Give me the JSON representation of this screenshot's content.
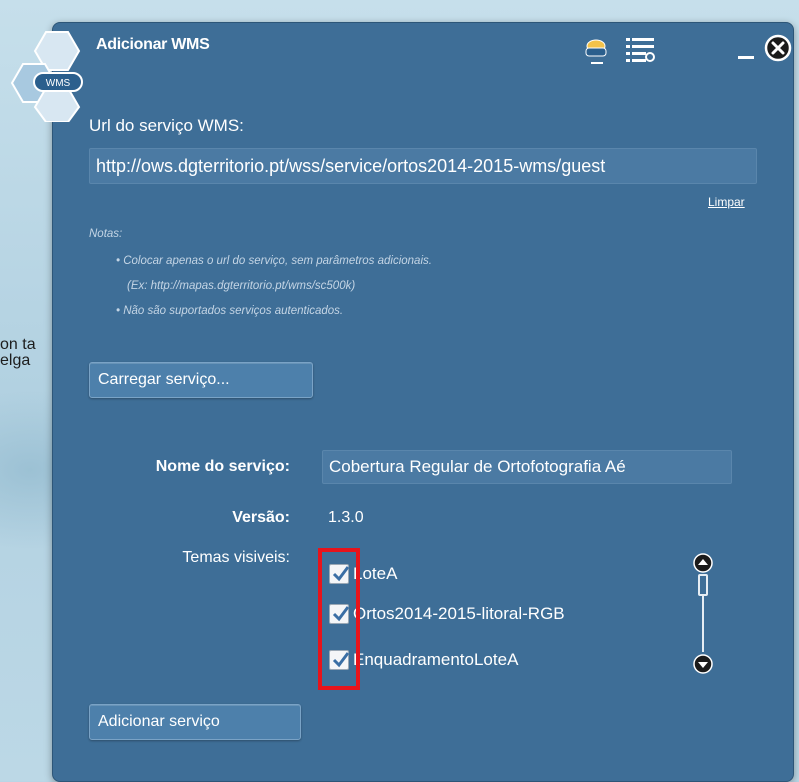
{
  "map": {
    "label_line1": "on ta",
    "label_line2": "elga"
  },
  "window": {
    "title": "Adicionar WMS",
    "logo_text": "WMS",
    "header_icons": [
      "wms-layer-icon",
      "list-settings-icon"
    ],
    "minimize_icon": "minimize-icon",
    "close_icon": "close-icon"
  },
  "url": {
    "label": "Url do serviço WMS:",
    "value": "http://ows.dgterritorio.pt/wss/service/ortos2014-2015-wms/guest",
    "clear_link": "Limpar"
  },
  "notes": {
    "title": "Notas:",
    "line1": "• Colocar apenas o url do serviço, sem parâmetros adicionais.",
    "line2": "(Ex: http://mapas.dgterritorio.pt/wms/sc500k)",
    "line3": "• Não são suportados serviços autenticados."
  },
  "buttons": {
    "load": "Carregar serviço...",
    "add": "Adicionar serviço"
  },
  "service": {
    "name_label": "Nome do serviço:",
    "name_value": "Cobertura Regular de Ortofotografia Aé",
    "version_label": "Versão:",
    "version_value": "1.3.0",
    "themes_label": "Temas visiveis:"
  },
  "layers": [
    {
      "label": "LoteA",
      "checked": true
    },
    {
      "label": "Ortos2014-2015-litoral-RGB",
      "checked": true
    },
    {
      "label": "EnquadramentoLoteA",
      "checked": true
    }
  ],
  "colors": {
    "panel": "#3e6e97",
    "highlight_box": "#e8141b"
  }
}
